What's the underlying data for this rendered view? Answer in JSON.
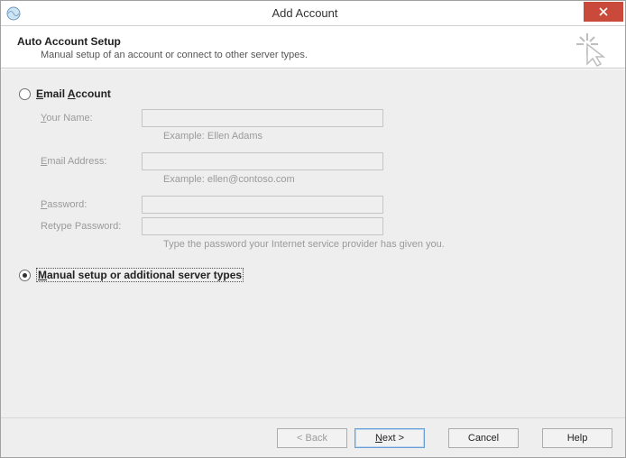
{
  "title": "Add Account",
  "header": {
    "title": "Auto Account Setup",
    "subtitle": "Manual setup of an account or connect to other server types."
  },
  "options": {
    "email": {
      "label": "Email Account",
      "selected": false
    },
    "manual": {
      "label": "Manual setup or additional server types",
      "selected": true
    }
  },
  "fields": {
    "name_label": "Your Name:",
    "name_hint": "Example: Ellen Adams",
    "email_label": "Email Address:",
    "email_hint": "Example: ellen@contoso.com",
    "password_label": "Password:",
    "retype_label": "Retype Password:",
    "password_hint": "Type the password your Internet service provider has given you."
  },
  "buttons": {
    "back": "< Back",
    "next": "Next >",
    "cancel": "Cancel",
    "help": "Help"
  }
}
